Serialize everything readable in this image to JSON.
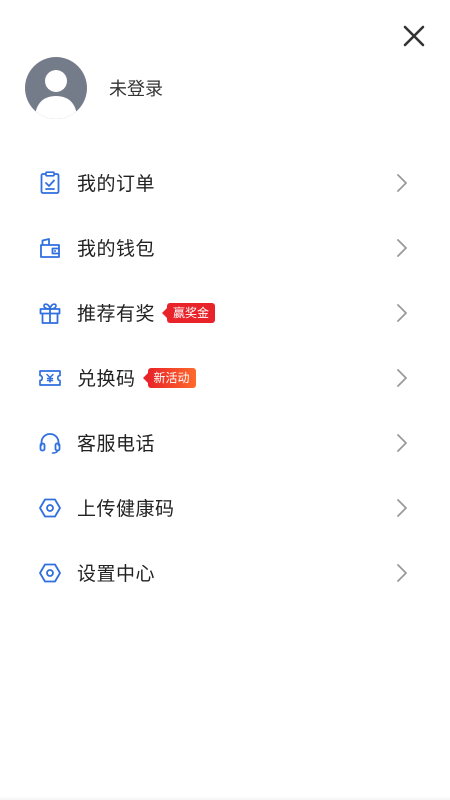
{
  "close_button": {
    "icon": "close-icon"
  },
  "profile": {
    "avatar_icon": "user-avatar-icon",
    "status_text": "未登录"
  },
  "menu": {
    "items": [
      {
        "label": "我的订单",
        "icon": "order-clipboard-icon"
      },
      {
        "label": "我的钱包",
        "icon": "wallet-icon"
      },
      {
        "label": "推荐有奖",
        "icon": "gift-icon",
        "badge": "赢奖金"
      },
      {
        "label": "兑换码",
        "icon": "redeem-coupon-icon",
        "badge": "新活动"
      },
      {
        "label": "客服电话",
        "icon": "headset-icon"
      },
      {
        "label": "上传健康码",
        "icon": "hexagon-icon"
      },
      {
        "label": "设置中心",
        "icon": "hexagon-icon"
      }
    ]
  },
  "colors": {
    "accent_blue": "#2f6fe0",
    "badge_red": "#e8232a",
    "badge_orange": "#ff6a2b",
    "chevron_gray": "#9a9a9a",
    "avatar_bg": "#757c89"
  }
}
